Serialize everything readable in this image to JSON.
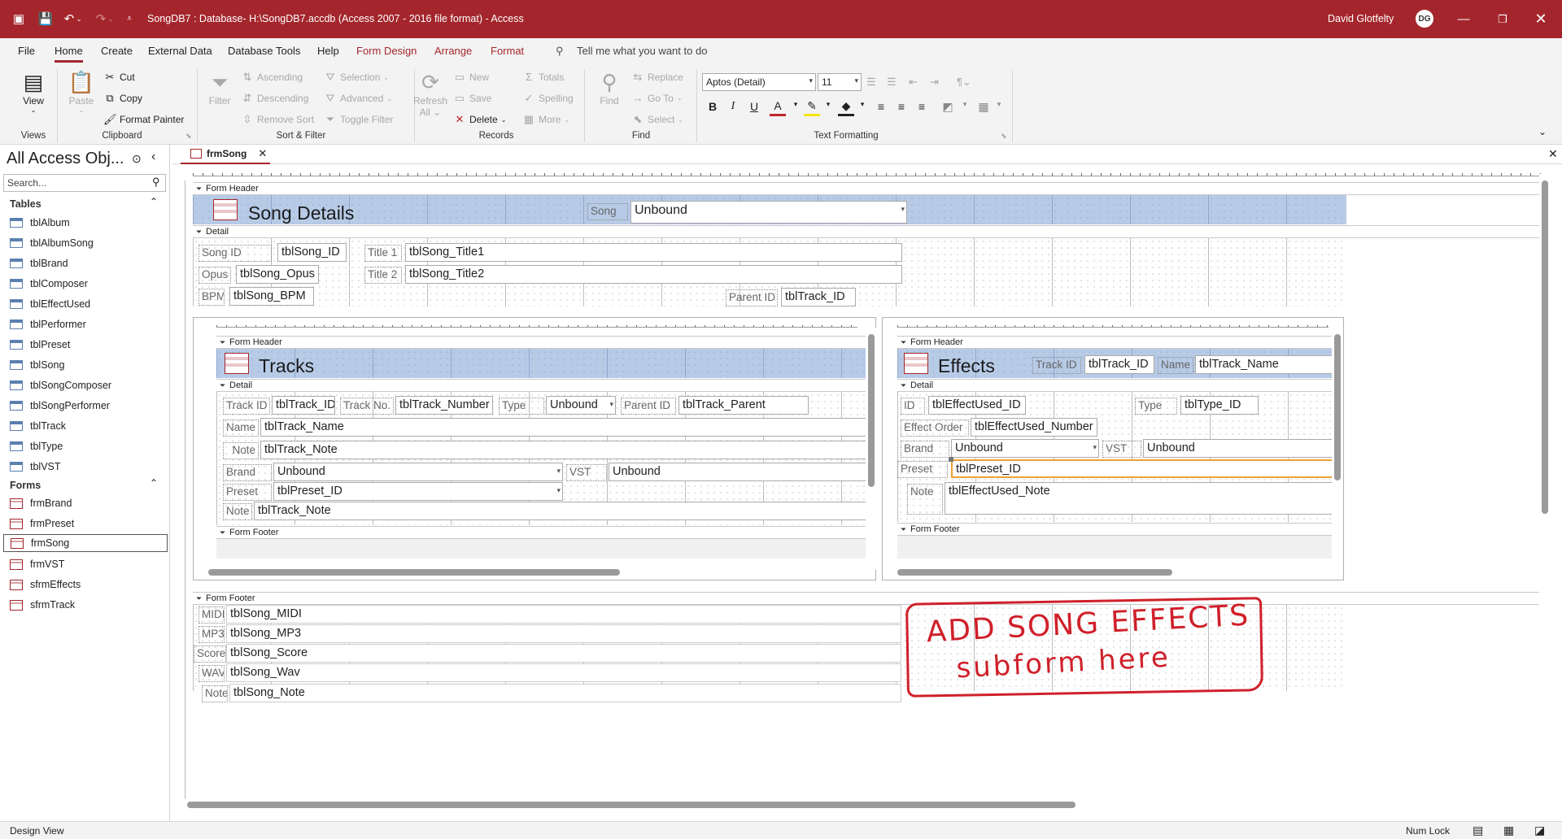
{
  "titlebar": {
    "title": "SongDB7 : Database- H:\\SongDB7.accdb (Access 2007 - 2016 file format) - Access",
    "user": "David Glotfelty",
    "avatar": "DG"
  },
  "menu": {
    "tabs": [
      "File",
      "Home",
      "Create",
      "External Data",
      "Database Tools",
      "Help",
      "Form Design",
      "Arrange",
      "Format"
    ],
    "tell_me": "Tell me what you want to do"
  },
  "ribbon": {
    "views": {
      "view": "View",
      "group": "Views"
    },
    "clipboard": {
      "paste": "Paste",
      "cut": "Cut",
      "copy": "Copy",
      "format_painter": "Format Painter",
      "group": "Clipboard"
    },
    "sort": {
      "filter": "Filter",
      "ascending": "Ascending",
      "descending": "Descending",
      "remove_sort": "Remove Sort",
      "selection": "Selection",
      "advanced": "Advanced",
      "toggle_filter": "Toggle Filter",
      "group": "Sort & Filter"
    },
    "records": {
      "refresh": "Refresh",
      "refresh2": "All",
      "new": "New",
      "save": "Save",
      "delete": "Delete",
      "totals": "Totals",
      "spelling": "Spelling",
      "more": "More",
      "group": "Records"
    },
    "find": {
      "find": "Find",
      "replace": "Replace",
      "goto": "Go To",
      "select": "Select",
      "group": "Find"
    },
    "text": {
      "font": "Aptos (Detail)",
      "size": "11",
      "bold": "B",
      "italic": "I",
      "underline": "U",
      "group": "Text Formatting"
    }
  },
  "nav": {
    "title": "All Access Obj...",
    "search_placeholder": "Search...",
    "tables_label": "Tables",
    "tables": [
      "tblAlbum",
      "tblAlbumSong",
      "tblBrand",
      "tblComposer",
      "tblEffectUsed",
      "tblPerformer",
      "tblPreset",
      "tblSong",
      "tblSongComposer",
      "tblSongPerformer",
      "tblTrack",
      "tblType",
      "tblVST"
    ],
    "forms_label": "Forms",
    "forms": [
      "frmBrand",
      "frmPreset",
      "frmSong",
      "frmVST",
      "sfrmEffects",
      "sfrmTrack"
    ]
  },
  "doc": {
    "tab_label": "frmSong",
    "form_header": "Form Header",
    "detail": "Detail",
    "form_footer": "Form Footer",
    "title": "Song Details",
    "song_label": "Song",
    "song_combo": "Unbound",
    "detail_fields": {
      "songid_l": "Song ID",
      "songid_t": "tblSong_ID",
      "opus_l": "Opus",
      "opus_t": "tblSong_Opus",
      "bpm_l": "BPM",
      "bpm_t": "tblSong_BPM",
      "title1_l": "Title 1",
      "title1_t": "tblSong_Title1",
      "title2_l": "Title 2",
      "title2_t": "tblSong_Title2",
      "parent_l": "Parent ID",
      "parent_t": "tblTrack_ID"
    },
    "tracks": {
      "title": "Tracks",
      "trackid_l": "Track ID",
      "trackid_t": "tblTrack_ID",
      "trackno_l": "Track No.",
      "trackno_t": "tblTrack_Number",
      "type_l": "Type",
      "type_t": "Unbound",
      "parent_l": "Parent ID",
      "parent_t": "tblTrack_Parent",
      "name_l": "Name",
      "name_t": "tblTrack_Name",
      "note_l": "Note",
      "note_t": "tblTrack_Note",
      "brand_l": "Brand",
      "brand_t": "Unbound",
      "vst_l": "VST",
      "vst_t": "Unbound",
      "preset_l": "Preset",
      "preset_t": "tblPreset_ID",
      "note2_l": "Note",
      "note2_t": "tblTrack_Note"
    },
    "effects": {
      "title": "Effects",
      "trackid_l": "Track ID",
      "trackid_t": "tblTrack_ID",
      "name_l": "Name",
      "name_t": "tblTrack_Name",
      "id_l": "ID",
      "id_t": "tblEffectUsed_ID",
      "type_l": "Type",
      "type_t": "tblType_ID",
      "order_l": "Effect Order",
      "order_t": "tblEffectUsed_Number",
      "brand_l": "Brand",
      "brand_t": "Unbound",
      "vst_l": "VST",
      "vst_t": "Unbound",
      "preset_l": "Preset",
      "preset_t": "tblPreset_ID",
      "note_l": "Note",
      "note_t": "tblEffectUsed_Note"
    },
    "footer_fields": {
      "midi_l": "MIDI",
      "midi_t": "tblSong_MIDI",
      "mp3_l": "MP3",
      "mp3_t": "tblSong_MP3",
      "score_l": "Score",
      "score_t": "tblSong_Score",
      "wav_l": "WAV",
      "wav_t": "tblSong_Wav",
      "note_l": "Note",
      "note_t": "tblSong_Note"
    },
    "annotation_line1": "ADD SONG EFFECTS",
    "annotation_line2": "subform here",
    "annotation_color": "#d0202a"
  },
  "status": {
    "left": "Design View",
    "right": "Num Lock"
  },
  "colors": {
    "accent": "#a4262c",
    "header_blue": "#b7cbe7"
  }
}
